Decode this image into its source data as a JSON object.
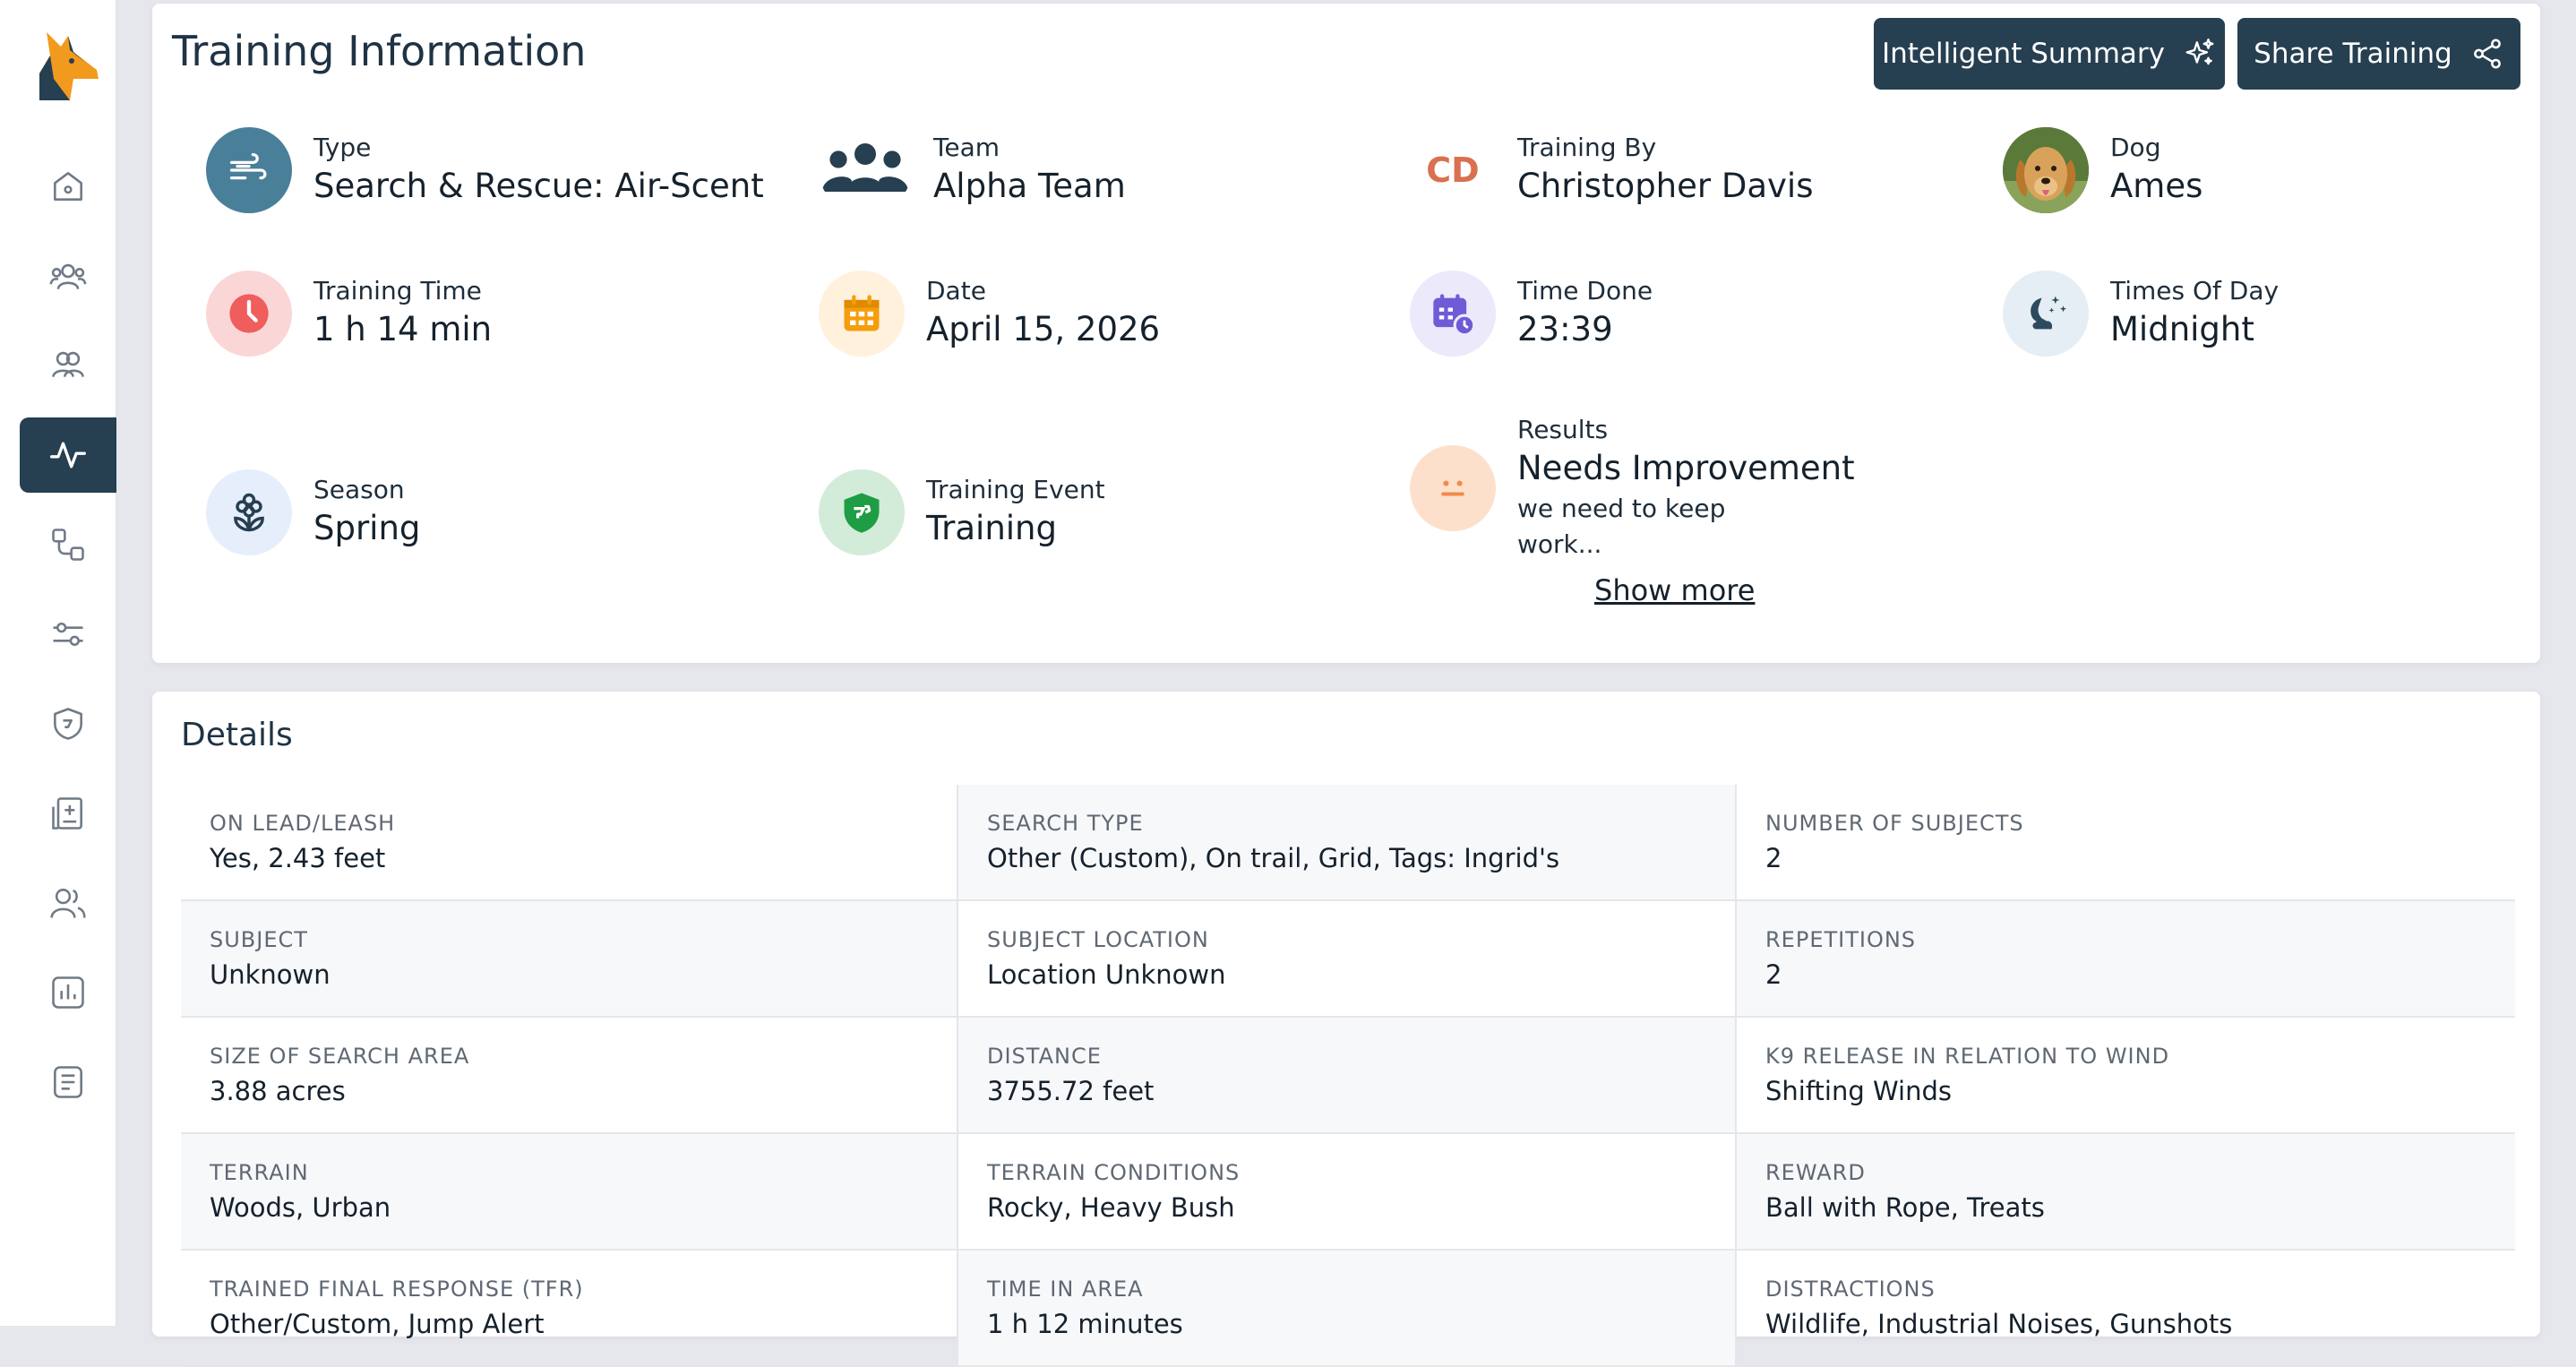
{
  "header": {
    "title": "Training Information",
    "summary_button": "Intelligent Summary",
    "share_button": "Share Training"
  },
  "info": {
    "type": {
      "label": "Type",
      "value": "Search & Rescue: Air-Scent"
    },
    "team": {
      "label": "Team",
      "value": "Alpha Team"
    },
    "trainer": {
      "label": "Training By",
      "value": "Christopher Davis",
      "initials": "CD"
    },
    "dog": {
      "label": "Dog",
      "value": "Ames"
    },
    "training_time": {
      "label": "Training Time",
      "value": "1 h 14 min"
    },
    "date": {
      "label": "Date",
      "value": "April 15, 2026"
    },
    "time_done": {
      "label": "Time Done",
      "value": "23:39"
    },
    "times_of_day": {
      "label": "Times Of Day",
      "value": "Midnight"
    },
    "season": {
      "label": "Season",
      "value": "Spring"
    },
    "training_event": {
      "label": "Training Event",
      "value": "Training"
    },
    "results": {
      "label": "Results",
      "value": "Needs Improvement",
      "note": "we need to keep work...",
      "show_more": "Show more"
    }
  },
  "details": {
    "title": "Details",
    "rows": [
      [
        {
          "key": "ON LEAD/LEASH",
          "value": "Yes, 2.43 feet"
        },
        {
          "key": "SEARCH TYPE",
          "value": "Other (Custom), On trail, Grid, Tags: Ingrid's"
        },
        {
          "key": "NUMBER OF SUBJECTS",
          "value": "2"
        }
      ],
      [
        {
          "key": "SUBJECT",
          "value": "Unknown"
        },
        {
          "key": "SUBJECT LOCATION",
          "value": "Location Unknown"
        },
        {
          "key": "REPETITIONS",
          "value": "2"
        }
      ],
      [
        {
          "key": "SIZE OF SEARCH AREA",
          "value": "3.88 acres"
        },
        {
          "key": "DISTANCE",
          "value": "3755.72 feet"
        },
        {
          "key": "K9 RELEASE IN RELATION TO WIND",
          "value": "Shifting Winds"
        }
      ],
      [
        {
          "key": "TERRAIN",
          "value": "Woods, Urban"
        },
        {
          "key": "TERRAIN CONDITIONS",
          "value": "Rocky, Heavy Bush"
        },
        {
          "key": "REWARD",
          "value": "Ball with Rope, Treats"
        }
      ],
      [
        {
          "key": "TRAINED FINAL RESPONSE (TFR)",
          "value": "Other/Custom, Jump Alert"
        },
        {
          "key": "TIME IN AREA",
          "value": "1 h 12 minutes"
        },
        {
          "key": "DISTRACTIONS",
          "value": "Wildlife, Industrial Noises, Gunshots"
        }
      ]
    ]
  },
  "colors": {
    "primary": "#263f51",
    "type_icon_bg": "#4a7f99",
    "clock_bg": "#fbd6d6",
    "clock_fg": "#ef5d5d",
    "calendar_bg": "#fff1dc",
    "calendar_fg": "#f59e0b",
    "time_done_bg": "#ece9fb",
    "time_done_fg": "#6e5bd6",
    "night_bg": "#e5eef4",
    "season_bg": "#e7eefb",
    "event_bg": "#d2ecd9",
    "event_fg": "#1f9d45",
    "result_bg": "#fde0cc",
    "result_fg": "#f38a4a",
    "initials": "#d9704f"
  },
  "icons": {
    "sidebar": [
      "home-icon",
      "users-group-icon",
      "teams-icon",
      "activity-icon",
      "workflow-icon",
      "settings-sliders-icon",
      "badge-shield-icon",
      "medical-record-icon",
      "people-icon",
      "reports-chart-icon",
      "notes-icon"
    ]
  }
}
